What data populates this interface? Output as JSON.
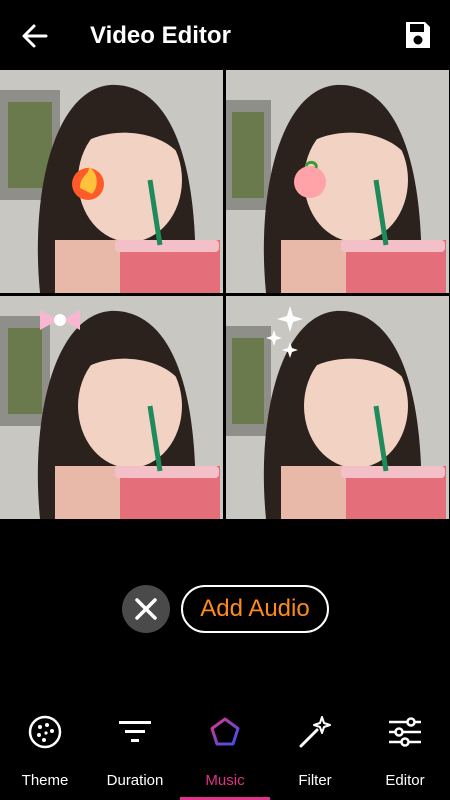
{
  "header": {
    "title": "Video Editor",
    "back_icon": "arrow-left-icon",
    "save_icon": "save-floppy-icon"
  },
  "preview": {
    "stickers": [
      "fire-icon",
      "peach-icon",
      "bow-icon",
      "sparkles-icon"
    ]
  },
  "audio": {
    "remove_icon": "close-x-icon",
    "add_label": "Add Audio",
    "accent_color": "#ff8a1c"
  },
  "nav": {
    "active_color": "#e0338a",
    "items": [
      {
        "label": "Theme",
        "icon": "theme-palette-icon"
      },
      {
        "label": "Duration",
        "icon": "duration-lines-icon"
      },
      {
        "label": "Music",
        "icon": "music-pentagon-icon"
      },
      {
        "label": "Filter",
        "icon": "magic-wand-icon"
      },
      {
        "label": "Editor",
        "icon": "sliders-icon"
      }
    ],
    "active_index": 2
  }
}
